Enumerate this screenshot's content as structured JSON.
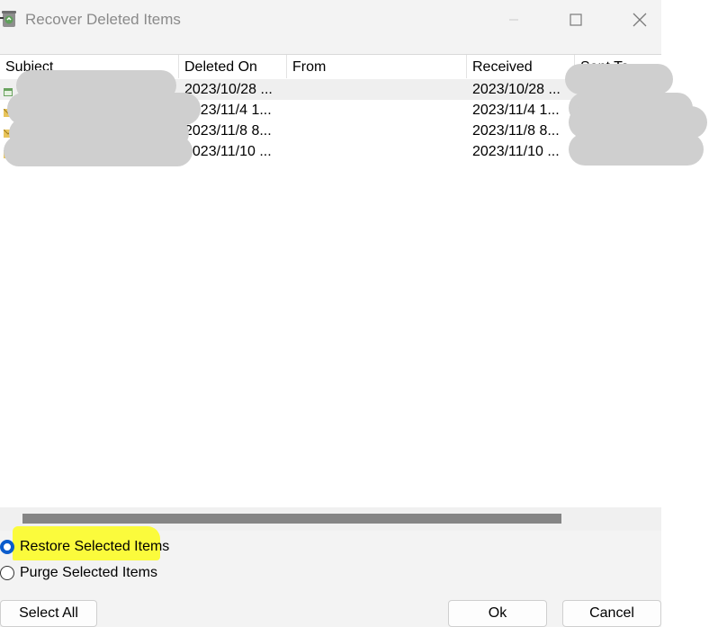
{
  "window": {
    "title": "Recover Deleted Items"
  },
  "list": {
    "columns": [
      {
        "key": "subject",
        "label": "Subject"
      },
      {
        "key": "deleted_on",
        "label": "Deleted On"
      },
      {
        "key": "from",
        "label": "From"
      },
      {
        "key": "received",
        "label": "Received"
      },
      {
        "key": "sent_to",
        "label": "Sent To"
      }
    ],
    "rows": [
      {
        "icon": "calendar-item-icon",
        "subject": "",
        "deleted_on": "2023/10/28 ...",
        "from": "",
        "received": "2023/10/28 ...",
        "sent_to": "",
        "selected": true
      },
      {
        "icon": "mail-item-icon",
        "subject": "",
        "deleted_on": "2023/11/4 1...",
        "from": "",
        "received": "2023/11/4 1...",
        "sent_to": "",
        "selected": false
      },
      {
        "icon": "mail-item-icon",
        "subject": "",
        "deleted_on": "2023/11/8 8...",
        "from": "",
        "received": "2023/11/8 8...",
        "sent_to": "",
        "selected": false
      },
      {
        "icon": "mail-item-icon",
        "subject": "",
        "deleted_on": "2023/11/10 ...",
        "from": "",
        "received": "2023/11/10 ...",
        "sent_to": "",
        "selected": false
      }
    ]
  },
  "options": {
    "restore_label": "Restore Selected Items",
    "purge_label": "Purge Selected Items",
    "selected": "restore"
  },
  "buttons": {
    "select_all": "Select All",
    "ok": "Ok",
    "cancel": "Cancel"
  },
  "colors": {
    "radio_accent": "#0a5ccc",
    "highlight": "#fbfb3c",
    "redaction": "#cfcfcf"
  }
}
